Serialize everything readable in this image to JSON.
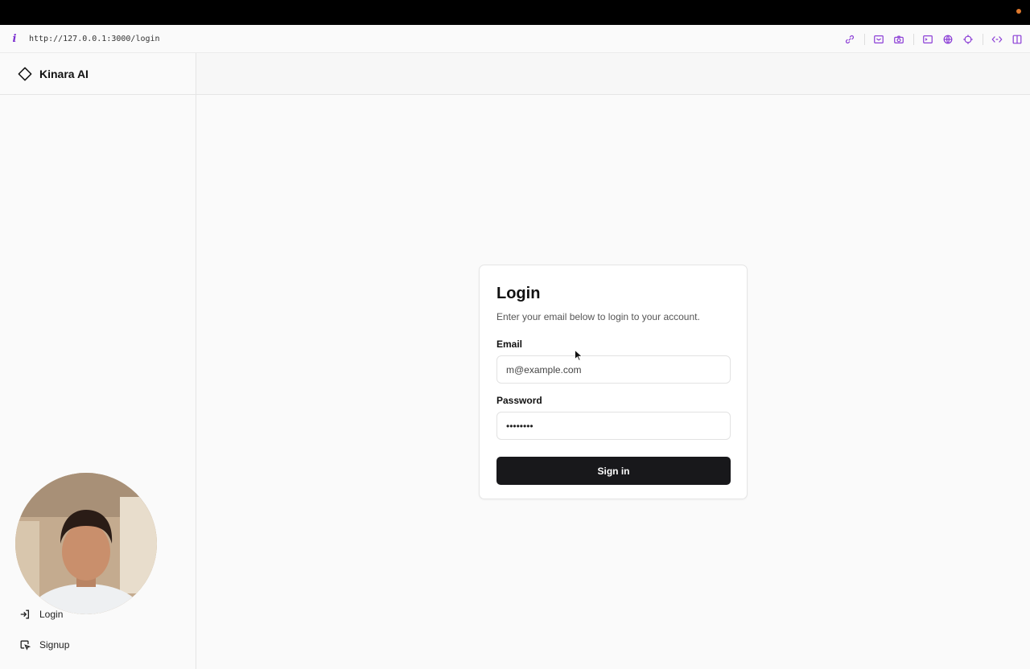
{
  "browser": {
    "url": "http://127.0.0.1:3000/login"
  },
  "app": {
    "name": "Kinara AI"
  },
  "sidebar": {
    "items": [
      {
        "label": "Login",
        "icon": "log-in-icon"
      },
      {
        "label": "Signup",
        "icon": "signup-icon"
      }
    ]
  },
  "login_card": {
    "title": "Login",
    "description": "Enter your email below to login to your account.",
    "email_label": "Email",
    "email_placeholder": "m@example.com",
    "password_label": "Password",
    "password_value": "••••••••",
    "submit_label": "Sign in"
  },
  "colors": {
    "accent": "#18181b",
    "toolbar_icon": "#8c3fd6",
    "recording_dot": "#e07a2e"
  }
}
